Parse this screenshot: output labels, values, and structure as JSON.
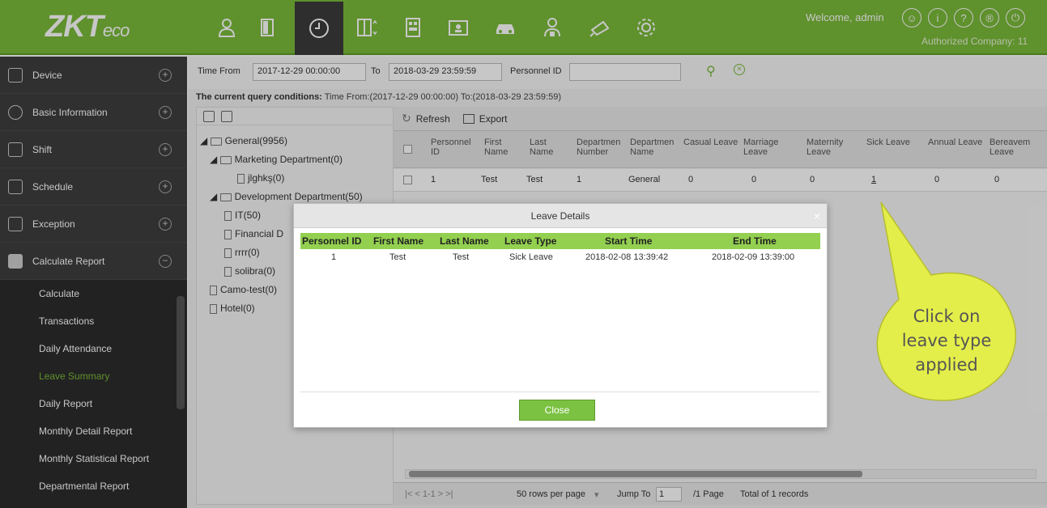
{
  "brand": {
    "logo_main": "ZKT",
    "logo_sub": "eco"
  },
  "nav_icons": [
    "personnel-icon",
    "access-door-icon",
    "attendance-clock-icon",
    "elevator-icon",
    "building-icon",
    "visitor-card-icon",
    "parking-car-icon",
    "patrol-guard-icon",
    "video-camera-icon",
    "settings-gear-icon"
  ],
  "header": {
    "welcome": "Welcome, admin",
    "company": "Authorized Company: 11",
    "util_icons": [
      "user-account-icon",
      "info-icon",
      "help-icon",
      "license-icon",
      "power-icon"
    ]
  },
  "sidebar": {
    "menus": [
      {
        "label": "Device"
      },
      {
        "label": "Basic Information"
      },
      {
        "label": "Shift"
      },
      {
        "label": "Schedule"
      },
      {
        "label": "Exception"
      },
      {
        "label": "Calculate Report"
      }
    ],
    "submenu": [
      {
        "label": "Calculate"
      },
      {
        "label": "Transactions"
      },
      {
        "label": "Daily Attendance"
      },
      {
        "label": "Leave Summary"
      },
      {
        "label": "Daily Report"
      },
      {
        "label": "Monthly Detail Report"
      },
      {
        "label": "Monthly Statistical Report"
      },
      {
        "label": "Departmental Report"
      }
    ],
    "active_submenu": "Leave Summary"
  },
  "filters": {
    "time_from_label": "Time From",
    "time_from_value": "2017-12-29 00:00:00",
    "to_label": "To",
    "to_value": "2018-03-29 23:59:59",
    "personnel_label": "Personnel ID",
    "personnel_value": ""
  },
  "query_conditions": {
    "label": "The current query conditions:",
    "value": "Time From:(2017-12-29 00:00:00)  To:(2018-03-29 23:59:59)"
  },
  "tree": {
    "root": "General(9956)",
    "items": [
      "Marketing Department(0)",
      "jlghkş(0)",
      "Development Department(50)",
      "IT(50)",
      "Financial D",
      "rrrr(0)",
      "solibra(0)",
      "Camo-test(0)",
      "Hotel(0)"
    ]
  },
  "toolbar": {
    "refresh": "Refresh",
    "export": "Export"
  },
  "table": {
    "columns": [
      "Personnel ID",
      "First Name",
      "Last Name",
      "Departmen Number",
      "Departmen Name",
      "Casual Leave",
      "Marriage Leave",
      "Maternity Leave",
      "Sick Leave",
      "Annual Leave",
      "Bereavem Leave"
    ],
    "rows": [
      {
        "personnel_id": "1",
        "first_name": "Test",
        "last_name": "Test",
        "dept_number": "1",
        "dept_name": "General",
        "casual": "0",
        "marriage": "0",
        "maternity": "0",
        "sick": "1",
        "annual": "0",
        "bereavement": "0"
      }
    ]
  },
  "pager": {
    "nav": "|<  <  1-1  >  >|",
    "rows_per_page": "50 rows per page",
    "jump_label": "Jump To",
    "jump_value": "1",
    "page_info": "/1 Page",
    "total": "Total of 1 records"
  },
  "modal": {
    "title": "Leave Details",
    "columns": [
      "Personnel ID",
      "First Name",
      "Last Name",
      "Leave Type",
      "Start Time",
      "End Time"
    ],
    "rows": [
      {
        "personnel_id": "1",
        "first_name": "Test",
        "last_name": "Test",
        "leave_type": "Sick Leave",
        "start": "2018-02-08 13:39:42",
        "end": "2018-02-09 13:39:00"
      }
    ],
    "close_label": "Close"
  },
  "callout": {
    "line1": "Click on",
    "line2": "leave type",
    "line3": "applied"
  },
  "colors": {
    "brand_green": "#7aba3a",
    "header_green": "#93d050",
    "sidebar_dark": "#3e3e3e",
    "callout_yellow": "#e4ee4a"
  }
}
